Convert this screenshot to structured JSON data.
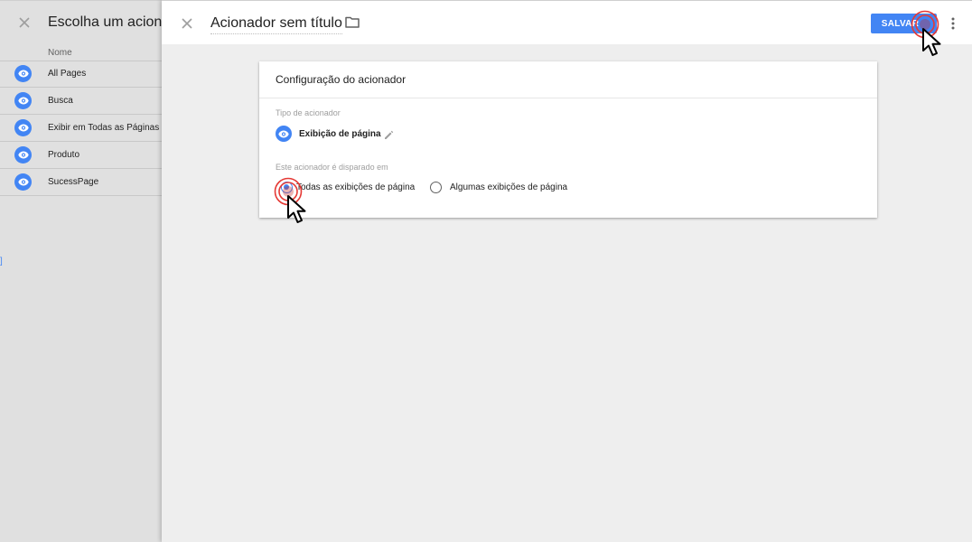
{
  "background_panel": {
    "title": "Escolha um acionador",
    "column_header": "Nome",
    "items": [
      {
        "label": "All Pages"
      },
      {
        "label": "Busca"
      },
      {
        "label": "Exibir em Todas as Páginas"
      },
      {
        "label": "Produto"
      },
      {
        "label": "SucessPage"
      }
    ],
    "side_glyph": "]",
    "item_icon": "eye-icon",
    "close_icon": "close-icon"
  },
  "editor": {
    "title": "Acionador sem título",
    "folder_icon": "folder-icon",
    "save_label": "SALVAR",
    "more_icon": "more-vert-icon",
    "close_icon": "close-icon"
  },
  "card": {
    "title": "Configuração do acionador",
    "type_label": "Tipo de acionador",
    "type_name": "Exibição de página",
    "fires_label": "Este acionador é disparado em",
    "options": [
      {
        "label": "Todas as exibições de página",
        "selected": true
      },
      {
        "label": "Algumas exibições de página",
        "selected": false
      }
    ]
  },
  "colors": {
    "accent": "#4285f4",
    "click_marker": "#e53935"
  }
}
